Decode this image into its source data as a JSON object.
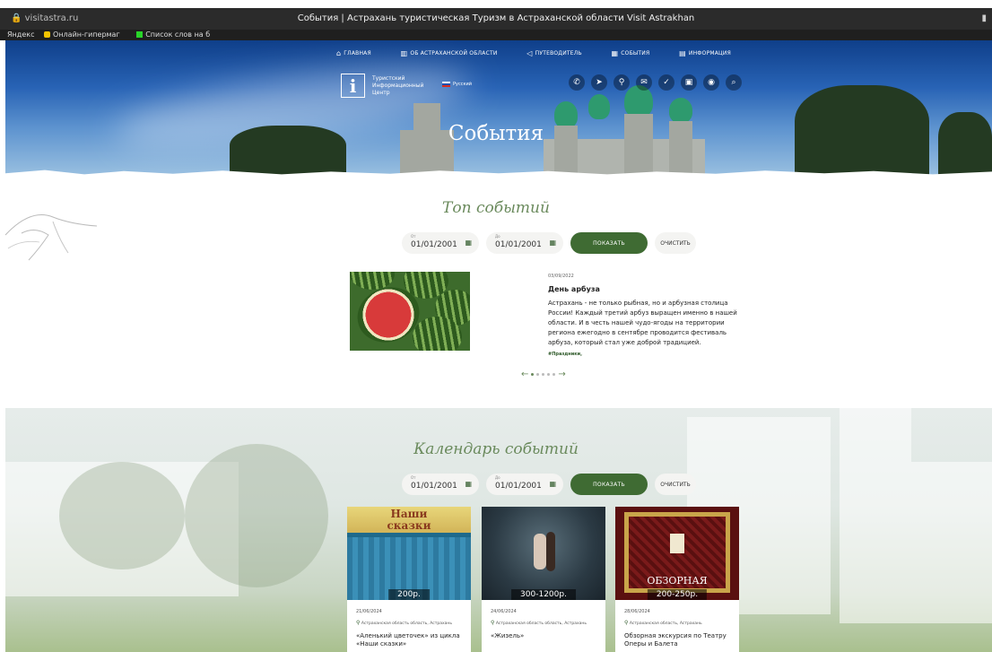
{
  "browser": {
    "url": "visitastra.ru",
    "title": "События | Астрахань туристическая Туризм в Астраханской области Visit Astrakhan",
    "bookmarks": [
      "Яндекс",
      "Онлайн-гипермаг",
      "Список слов на б"
    ]
  },
  "nav": {
    "items": [
      "ГЛАВНАЯ",
      "ОБ АСТРАХАНСКОЙ ОБЛАСТИ",
      "ПУТЕВОДИТЕЛЬ",
      "СОБЫТИЯ",
      "ИНФОРМАЦИЯ"
    ]
  },
  "logo": {
    "mark": "i",
    "line1": "Туристский",
    "line2": "Информационный",
    "line3": "Центр"
  },
  "language": {
    "selected": "Русский"
  },
  "hero": {
    "title": "События"
  },
  "top_events": {
    "title": "Топ событий",
    "filter": {
      "from_label": "От",
      "from_value": "01/01/2001",
      "to_label": "До",
      "to_value": "01/01/2001",
      "show_label": "ПОКАЗАТЬ",
      "clear_label": "ОЧИСТИТЬ"
    },
    "featured": {
      "date": "03/09/2022",
      "title": "День арбуза",
      "description": "Астрахань - не только рыбная, но и арбузная столица России! Каждый третий арбуз выращен именно в нашей области. И в честь нашей чудо-ягоды на территории региона ежегодно в сентябре проводится фестиваль арбуза, который стал уже доброй традицией.",
      "tag": "#Праздники,"
    },
    "pager": {
      "pages": 5,
      "active": 1
    }
  },
  "calendar": {
    "title": "Календарь событий",
    "filter": {
      "from_label": "От",
      "from_value": "01/01/2001",
      "to_label": "До",
      "to_value": "01/01/2001",
      "show_label": "ПОКАЗАТЬ",
      "clear_label": "ОЧИСТИТЬ"
    },
    "cards": [
      {
        "poster_text_1": "Наши",
        "poster_text_2": "сказки",
        "price": "200р.",
        "date": "21/06/2024",
        "location": "Астраханская область область, Астрахань",
        "title": "«Аленький цветочек» из цикла «Наши сказки»"
      },
      {
        "price": "300-1200р.",
        "date": "24/06/2024",
        "location": "Астраханская область область, Астрахань",
        "title": "«Жизель»"
      },
      {
        "poster_text_1": "ОБЗОРНАЯ",
        "price": "200-250р.",
        "date": "28/06/2024",
        "location": "Астраханская область, Астрахань",
        "title": "Обзорная экскурсия по Театру Оперы и Балета"
      }
    ]
  },
  "colors": {
    "accent_green": "#3f6b33",
    "title_green": "#6a8a5c"
  }
}
